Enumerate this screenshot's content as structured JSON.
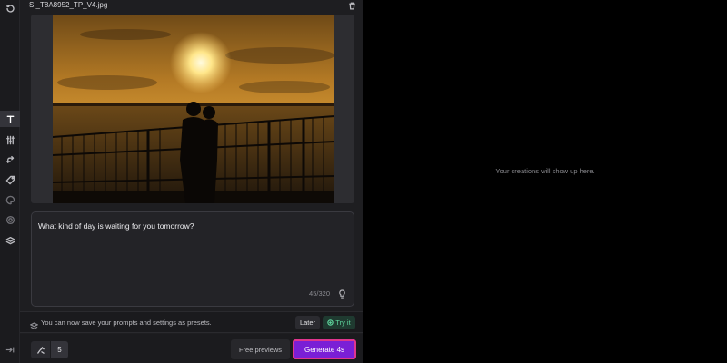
{
  "file": {
    "name": "SI_T8A8952_TP_V4.jpg"
  },
  "prompt": {
    "text": "What kind of day is waiting for you tomorrow?",
    "char_count": "45/320"
  },
  "preset_banner": {
    "message": "You can now save your prompts and settings as presets.",
    "later_label": "Later",
    "try_label": "Try it"
  },
  "footer": {
    "image_count": "5",
    "free_previews_label": "Free previews",
    "generate_label": "Generate 4s"
  },
  "results": {
    "empty_message": "Your creations will show up here."
  },
  "rail": {
    "tools": [
      {
        "icon": "history-icon",
        "active": false
      },
      {
        "icon": "text-icon",
        "active": true
      },
      {
        "icon": "sliders-icon",
        "active": false
      },
      {
        "icon": "arrow-loop-icon",
        "active": false
      },
      {
        "icon": "tag-icon",
        "active": false
      },
      {
        "icon": "palette-icon",
        "active": false
      },
      {
        "icon": "settings-icon",
        "active": false
      },
      {
        "icon": "layers-icon",
        "active": false
      }
    ]
  },
  "colors": {
    "panel_bg": "#1e1e21",
    "generate_bg": "#7a1fd6",
    "generate_border": "#e0358e",
    "try_text": "#5fd39c",
    "results_bg": "#000000"
  }
}
